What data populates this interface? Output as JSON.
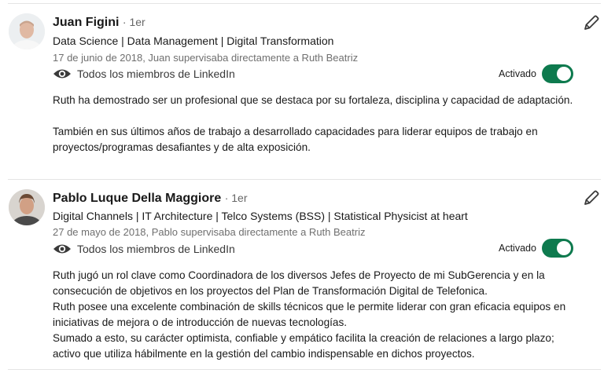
{
  "recommendations": [
    {
      "name": "Juan Figini",
      "degree": "· 1er",
      "headline": "Data Science | Data Management | Digital Transformation",
      "meta": "17 de junio de 2018, Juan supervisaba directamente a Ruth Beatriz",
      "visibility": "Todos los miembros de LinkedIn",
      "status": "Activado",
      "enabled": true,
      "body_paragraphs": [
        "Ruth ha demostrado ser un profesional que se destaca por su fortaleza, disciplina y capacidad de adaptación.",
        "También en sus últimos años de trabajo a desarrollado capacidades para liderar equipos de trabajo en proyectos/programas desafiantes y de alta exposición."
      ]
    },
    {
      "name": "Pablo Luque Della Maggiore",
      "degree": "· 1er",
      "headline": "Digital Channels | IT Architecture | Telco Systems (BSS) | Statistical Physicist at heart",
      "meta": "27 de mayo de 2018, Pablo supervisaba directamente a Ruth Beatriz",
      "visibility": "Todos los miembros de LinkedIn",
      "status": "Activado",
      "enabled": true,
      "body_lines": [
        "Ruth jugó un rol clave como Coordinadora de los diversos Jefes de Proyecto de mi SubGerencia y en la consecución de objetivos en los proyectos del Plan de Transformación Digital de Telefonica.",
        "Ruth posee una excelente combinación de skills técnicos que le permite liderar con gran eficacia equipos en iniciativas de mejora o de introducción de nuevas tecnologías.",
        "Sumado a esto, su carácter optimista, confiable y empático facilita la creación de relaciones a largo plazo; activo que utiliza hábilmente en la gestión del cambio indispensable en dichos proyectos."
      ]
    }
  ],
  "colors": {
    "toggle_on": "#0e7a4e",
    "meta_gray": "#6f6f6f",
    "divider": "#e4e4e4"
  },
  "icons": [
    "eye-icon",
    "pencil-icon",
    "avatar"
  ]
}
